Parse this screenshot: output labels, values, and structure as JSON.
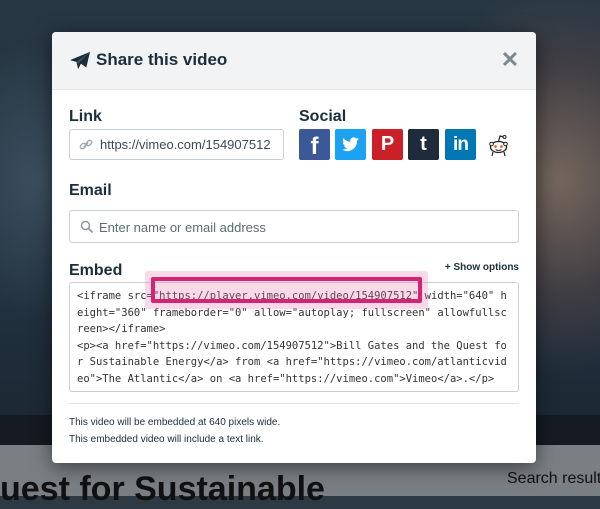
{
  "modal": {
    "title": "Share this video",
    "link": {
      "label": "Link",
      "value": "https://vimeo.com/154907512"
    },
    "social": {
      "label": "Social",
      "buttons": [
        {
          "name": "facebook",
          "glyph": "f",
          "color": "#3b5998"
        },
        {
          "name": "twitter",
          "glyph": "",
          "color": "#1da1f2"
        },
        {
          "name": "pinterest",
          "glyph": "P",
          "color": "#cb2027"
        },
        {
          "name": "tumblr",
          "glyph": "t",
          "color": "#1e2b3a"
        },
        {
          "name": "linkedin",
          "glyph": "in",
          "color": "#0077b5"
        },
        {
          "name": "reddit",
          "glyph": "",
          "color": "#ff4500"
        }
      ]
    },
    "email": {
      "label": "Email",
      "placeholder": "Enter name or email address"
    },
    "embed": {
      "label": "Embed",
      "show_options": "+ Show options",
      "code": "<iframe src=\"https://player.vimeo.com/video/154907512\" width=\"640\" height=\"360\" frameborder=\"0\" allow=\"autoplay; fullscreen\" allowfullscreen></iframe>\n<p><a href=\"https://vimeo.com/154907512\">Bill Gates and the Quest for Sustainable Energy</a> from <a href=\"https://vimeo.com/atlanticvideo\">The Atlantic</a> on <a href=\"https://vimeo.com\">Vimeo</a>.</p>"
    },
    "notes": [
      "This video will be embedded at 640 pixels wide.",
      "This embedded video will include a text link."
    ]
  },
  "background": {
    "title_fragment": "uest for Sustainable",
    "search_fragment": "Search result"
  },
  "colors": {
    "highlight": "#d62474",
    "text": "#1a2e3b"
  }
}
